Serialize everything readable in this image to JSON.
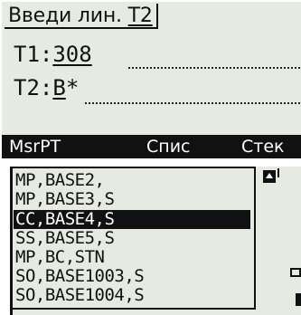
{
  "top_screen": {
    "title_part1": "Введи лин.",
    "title_part2": "T2",
    "fields": [
      {
        "label": "T1:",
        "value": "308"
      },
      {
        "label": "T2:",
        "value": "B",
        "value_suffix": "*"
      }
    ],
    "softkeys": [
      "MsrPT",
      "Спис",
      "Стек"
    ]
  },
  "bottom_screen": {
    "items": [
      "MP,BASE2,",
      "MP,BASE3,S",
      "CC,BASE4,S",
      "SS,BASE5,S",
      "MP,BC,STN",
      "SO,BASE1003,S",
      "SO,BASE1004,S"
    ],
    "selected_index": 2,
    "colors": {
      "screen_bg": "#e6ebe1",
      "ink": "#111111",
      "inverse_text": "#ffffff"
    }
  }
}
